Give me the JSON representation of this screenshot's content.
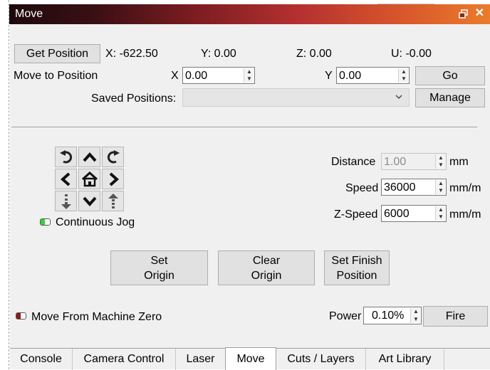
{
  "window": {
    "title": "Move",
    "restore_icon": "restore-window-icon",
    "close_label": "✕"
  },
  "position": {
    "get_label": "Get Position",
    "x": "X: -622.50",
    "y": "Y: 0.00",
    "z": "Z: 0.00",
    "u": "U: -0.00"
  },
  "move_to": {
    "label": "Move to Position",
    "x_label": "X",
    "x_value": "0.00",
    "y_label": "Y",
    "y_value": "0.00",
    "go_label": "Go"
  },
  "saved": {
    "label": "Saved Positions:",
    "value": "",
    "manage_label": "Manage"
  },
  "jog": {
    "icons": [
      "rotate-ccw-icon",
      "arrow-up-icon",
      "rotate-cw-icon",
      "arrow-left-icon",
      "home-icon",
      "arrow-right-icon",
      "z-down-icon",
      "arrow-down-icon",
      "z-up-icon"
    ],
    "continuous_label": "Continuous Jog",
    "continuous_on": true
  },
  "params": {
    "distance_label": "Distance",
    "distance_value": "1.00",
    "distance_unit": "mm",
    "speed_label": "Speed",
    "speed_value": "36000",
    "speed_unit": "mm/m",
    "zspeed_label": "Z-Speed",
    "zspeed_value": "6000",
    "zspeed_unit": "mm/m"
  },
  "origin": {
    "set_line1": "Set",
    "set_line2": "Origin",
    "clear_line1": "Clear",
    "clear_line2": "Origin",
    "finish_line1": "Set Finish",
    "finish_line2": "Position"
  },
  "bottom": {
    "machine_zero_label": "Move From Machine Zero",
    "machine_zero_on": false,
    "power_label": "Power",
    "power_value": "0.10%",
    "fire_label": "Fire"
  },
  "tabs": [
    {
      "label": "Console",
      "active": false
    },
    {
      "label": "Camera Control",
      "active": false
    },
    {
      "label": "Laser",
      "active": false
    },
    {
      "label": "Move",
      "active": true
    },
    {
      "label": "Cuts / Layers",
      "active": false
    },
    {
      "label": "Art Library",
      "active": false
    }
  ],
  "colors": {
    "led_on": "#3ccc3c",
    "led_off": "#8b1a1a",
    "title_gradient_start": "#1d0a0c",
    "title_gradient_end": "#ea7c2c"
  }
}
